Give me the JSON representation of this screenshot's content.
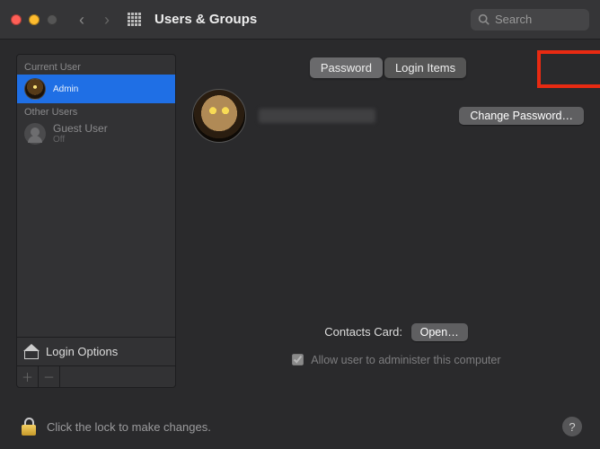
{
  "window": {
    "title": "Users & Groups",
    "search_placeholder": "Search"
  },
  "sidebar": {
    "current_user_header": "Current User",
    "other_users_header": "Other Users",
    "current": {
      "name": "",
      "role": "Admin"
    },
    "guest": {
      "name": "Guest User",
      "status": "Off"
    },
    "login_options": "Login Options"
  },
  "tabs": {
    "password": "Password",
    "login_items": "Login Items"
  },
  "pane": {
    "change_password": "Change Password…",
    "contacts_label": "Contacts Card:",
    "open": "Open…",
    "admin_checkbox": "Allow user to administer this computer"
  },
  "footer": {
    "lock_text": "Click the lock to make changes."
  }
}
